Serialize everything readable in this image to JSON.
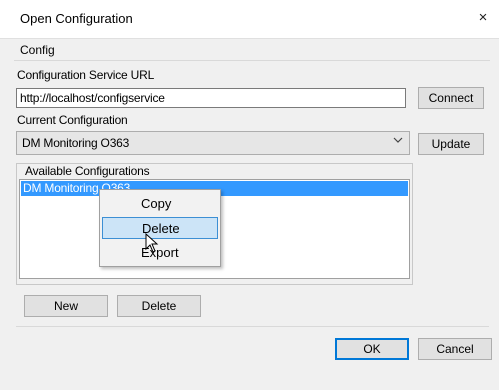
{
  "window": {
    "title": "Open Configuration",
    "close_glyph": "×"
  },
  "tab": {
    "label": "Config"
  },
  "service_url": {
    "label": "Configuration Service URL",
    "value": "http://localhost/configservice",
    "connect_label": "Connect"
  },
  "current_config": {
    "label": "Current Configuration",
    "selected": "DM Monitoring O363",
    "chevron_icon": "chevron-down-icon",
    "update_label": "Update"
  },
  "available": {
    "label": "Available Configurations",
    "items": [
      {
        "label": "DM Monitoring O363",
        "selected": true
      }
    ],
    "new_label": "New",
    "delete_label": "Delete"
  },
  "context_menu": {
    "items": [
      {
        "label": "Copy",
        "hovered": false
      },
      {
        "label": "Delete",
        "hovered": true
      },
      {
        "label": "Export",
        "hovered": false
      }
    ]
  },
  "footer": {
    "ok_label": "OK",
    "cancel_label": "Cancel"
  },
  "colors": {
    "selection": "#3399ff",
    "menu_hover": "#cce4f7",
    "default_button_border": "#0078d7"
  }
}
